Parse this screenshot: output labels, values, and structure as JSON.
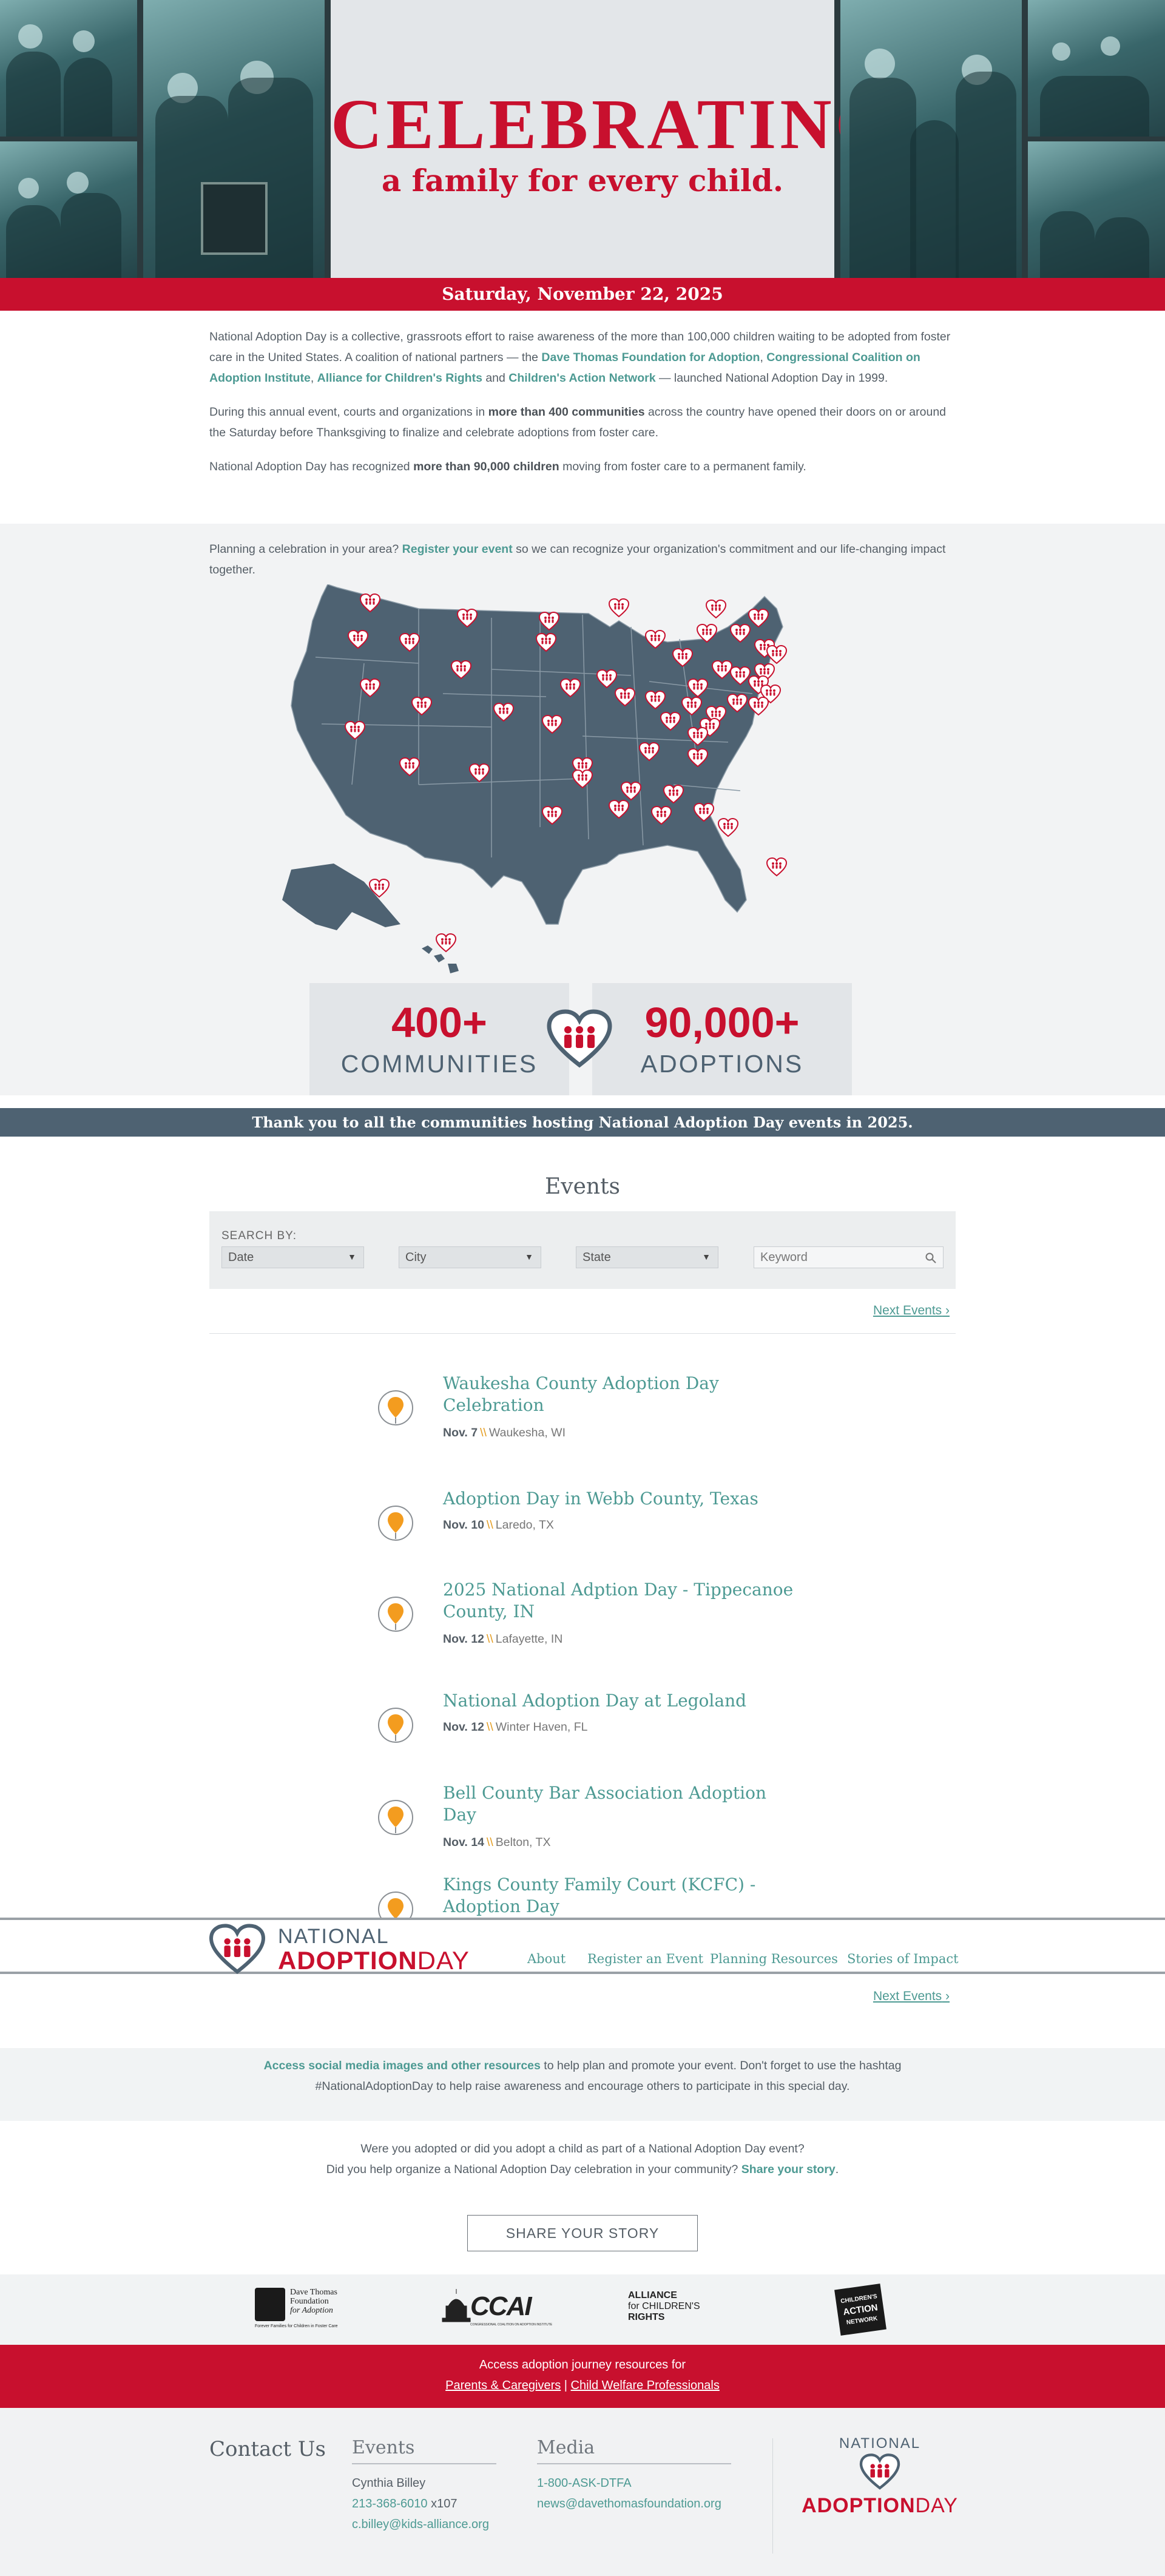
{
  "hero": {
    "title": "CELEBRATING",
    "subtitle": "a family for every child.",
    "date": "Saturday, November 22, 2025"
  },
  "intro": {
    "p1_a": "National Adoption Day is a collective, grassroots effort to raise awareness of the more than 100,000 children waiting to be adopted from foster care in the United States. A coalition of national partners — the ",
    "p1_link1": "Dave Thomas Foundation for Adoption",
    "p1_b": ", ",
    "p1_link2": "Congressional Coalition on Adoption Institute",
    "p1_c": ", ",
    "p1_link3": "Alliance for Children's Rights",
    "p1_d": " and ",
    "p1_link4": "Children's Action Network",
    "p1_e": " — launched National Adoption Day in 1999.",
    "p2_a": "During this annual event, courts and organizations in ",
    "p2_bold": "more than 400 communities",
    "p2_b": " across the country have opened their doors on or around the Saturday before Thanksgiving to finalize and celebrate adoptions from foster care.",
    "p3_a": "National Adoption Day has recognized ",
    "p3_bold": "more than 90,000 children",
    "p3_b": " moving from foster care to a permanent family."
  },
  "plan": {
    "a": "Planning a celebration in your area? ",
    "link": "Register your event",
    "b": " so we can recognize your organization's commitment and our life-changing impact together."
  },
  "stats": {
    "left_num": "400+",
    "left_label": "COMMUNITIES",
    "right_num": "90,000+",
    "right_label": "ADOPTIONS"
  },
  "thanks": "Thank you to all the communities hosting National Adoption Day events in 2025.",
  "events": {
    "title": "Events",
    "search_label": "SEARCH BY:",
    "date_select": "Date",
    "city_select": "City",
    "state_select": "State",
    "keyword_placeholder": "Keyword",
    "next_label": "Next Events",
    "items": [
      {
        "title": "Waukesha County Adoption Day Celebration",
        "date": "Nov. 7",
        "place": "Waukesha, WI"
      },
      {
        "title": "Adoption Day in Webb County, Texas",
        "date": "Nov. 10",
        "place": "Laredo, TX"
      },
      {
        "title": "2025 National Adption Day - Tippecanoe County, IN",
        "date": "Nov. 12",
        "place": "Lafayette, IN"
      },
      {
        "title": "National Adoption Day at Legoland",
        "date": "Nov. 12",
        "place": "Winter Haven, FL"
      },
      {
        "title": "Bell County Bar Association Adoption Day",
        "date": "Nov. 14",
        "place": "Belton, TX"
      },
      {
        "title": "Kings County Family Court (KCFC) - Adoption Day",
        "date": "",
        "place": ""
      }
    ],
    "sep": "\\\\"
  },
  "nav": {
    "logo_top": "NATIONAL",
    "logo_adoption": "ADOPTION",
    "logo_day": "DAY",
    "items": [
      "About",
      "Register an Event",
      "Planning Resources",
      "Stories of Impact"
    ]
  },
  "social": {
    "link": "Access social media images and other resources",
    "a": " to help plan and promote your event. Don't forget to use the hashtag",
    "b": "#NationalAdoptionDay to help raise awareness and encourage others to participate in this special day."
  },
  "share": {
    "line1": "Were you adopted or did you adopt a child as part of a National Adoption Day event?",
    "line2_a": "Did you help organize a National Adoption Day celebration in your community? ",
    "line2_link": "Share your story",
    "line2_b": ".",
    "button": "SHARE YOUR STORY"
  },
  "partners": {
    "dave1": "Dave Thomas",
    "dave2": "Foundation",
    "dave3": "for Adoption",
    "dave4": "Forever Families for Children in Foster Care",
    "ccai": "CCAI",
    "ccai_sub": "CONGRESSIONAL COALITION ON ADOPTION INSTITUTE",
    "acr1": "ALLIANCE",
    "acr2": "for CHILDREN'S",
    "acr3": "RIGHTS",
    "can1": "CHILDREN'S",
    "can2": "ACTION",
    "can3": "NETWORK"
  },
  "resources": {
    "line1": "Access adoption journey resources for",
    "link1": "Parents & Caregivers",
    "sep": " | ",
    "link2": "Child Welfare Professionals"
  },
  "footer": {
    "contact": "Contact Us",
    "events_title": "Events",
    "events_name": "Cynthia Billey",
    "events_phone": "213-368-6010",
    "events_ext": " x107",
    "events_email": "c.billey@kids-alliance.org",
    "media_title": "Media",
    "media_phone": "1-800-ASK-DTFA",
    "media_email": "news@davethomasfoundation.org",
    "logo_top": "NATIONAL",
    "logo_adoption": "ADOPTION",
    "logo_day": "DAY"
  },
  "colors": {
    "brand_red": "#c8102e",
    "slate": "#4e6272",
    "teal_link": "#4d9a93",
    "pin_orange": "#f39c1f"
  }
}
